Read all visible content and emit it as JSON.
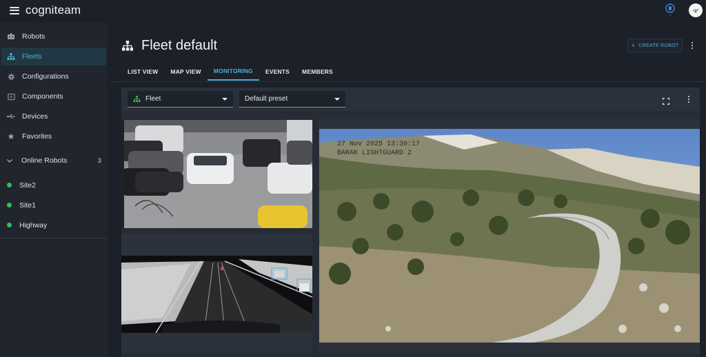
{
  "app": {
    "logo": "cogniteam"
  },
  "sidebar": {
    "items": [
      {
        "label": "Robots",
        "icon": "robot-icon"
      },
      {
        "label": "Fleets",
        "icon": "fleet-icon"
      },
      {
        "label": "Configurations",
        "icon": "gear-icon"
      },
      {
        "label": "Components",
        "icon": "component-icon"
      },
      {
        "label": "Devices",
        "icon": "usb-icon"
      },
      {
        "label": "Favorites",
        "icon": "star-icon"
      }
    ],
    "online_section": {
      "label": "Online Robots",
      "count": "3"
    },
    "robots": [
      {
        "label": "Site2",
        "status_color": "#2fbf5a"
      },
      {
        "label": "Site1",
        "status_color": "#2fbf5a"
      },
      {
        "label": "Highway",
        "status_color": "#2fbf5a"
      }
    ]
  },
  "header": {
    "title": "Fleet default",
    "create_button": "CREATE ROBOT"
  },
  "tabs": [
    {
      "label": "LIST VIEW"
    },
    {
      "label": "MAP VIEW"
    },
    {
      "label": "MONITORING"
    },
    {
      "label": "EVENTS"
    },
    {
      "label": "MEMBERS"
    }
  ],
  "monitoring": {
    "fleet_select": "Fleet",
    "preset_select": "Default preset",
    "feeds": {
      "overlay_date": "27 Nov 2025",
      "overlay_time": "13:30:17",
      "overlay_camera": "BARAK LIGHTGUARD 2"
    }
  },
  "colors": {
    "accent": "#4fb0d3",
    "online": "#2fbf5a",
    "fleet_icon": "#3fb65a"
  }
}
